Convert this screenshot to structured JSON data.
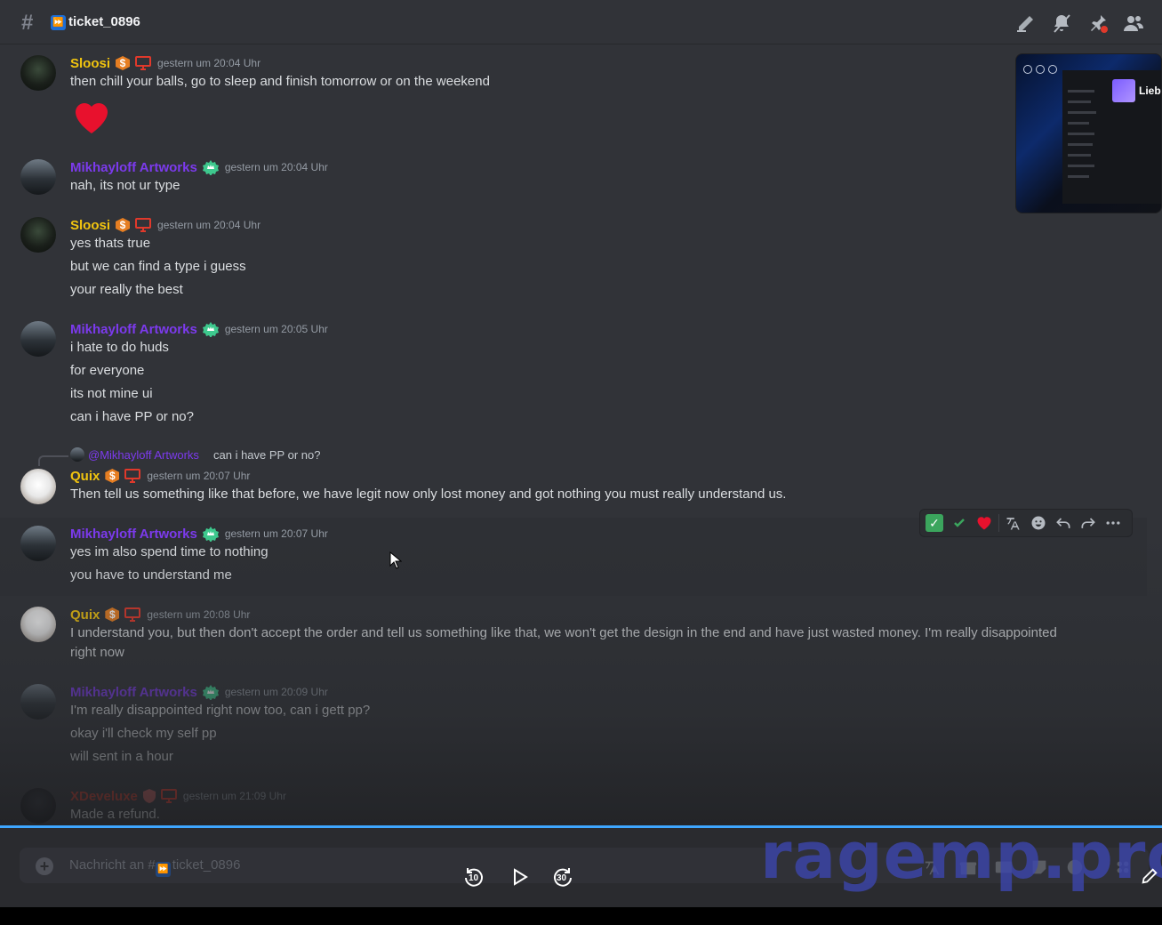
{
  "channel": {
    "name": "ticket_0896",
    "emoji": "⏩"
  },
  "messages": [
    {
      "author": "Sloosi",
      "timestamp": "gestern um 20:04 Uhr",
      "lines": [
        "then chill your balls, go to sleep and finish tomorrow or on the weekend"
      ],
      "emoji": "heart"
    },
    {
      "author": "Mikhayloff Artworks",
      "timestamp": "gestern um 20:04 Uhr",
      "lines": [
        "nah, its not ur type"
      ]
    },
    {
      "author": "Sloosi",
      "timestamp": "gestern um 20:04 Uhr",
      "lines": [
        "yes thats true",
        "but we can find a type i guess",
        "your really the best"
      ]
    },
    {
      "author": "Mikhayloff Artworks",
      "timestamp": "gestern um 20:05 Uhr",
      "lines": [
        "i hate to do huds",
        "for everyone",
        "its not mine ui",
        "can i have PP or no?"
      ]
    },
    {
      "author": "Quix",
      "timestamp": "gestern um 20:07 Uhr",
      "reply": {
        "mention": "@Mikhayloff Artworks",
        "text": "can i have PP or no?"
      },
      "lines": [
        "Then tell us something like that before, we have legit now only lost money and got nothing you must really understand us."
      ]
    },
    {
      "author": "Mikhayloff Artworks",
      "timestamp": "gestern um 20:07 Uhr",
      "lines": [
        "yes im also spend time to nothing",
        "you have to understand me"
      ]
    },
    {
      "author": "Quix",
      "timestamp": "gestern um 20:08 Uhr",
      "lines": [
        "I understand you, but then don't accept the order and tell us something like that, we won't get the design in the end and have just wasted money. I'm really disappointed right now"
      ]
    },
    {
      "author": "Mikhayloff Artworks",
      "timestamp": "gestern um 20:09 Uhr",
      "lines": [
        "I'm really disappointed right now too, can i gett pp?",
        "okay i'll check my self pp",
        "will sent in a hour"
      ]
    },
    {
      "author": "XDeveluxe",
      "timestamp": "gestern um 21:09 Uhr",
      "lines": [
        "Made a refund."
      ]
    }
  ],
  "thumbnail": {
    "label": "Liebl"
  },
  "composer": {
    "placeholder_prefix": "Nachricht an #",
    "placeholder_channel": "ticket_0896"
  },
  "player": {
    "rewind_seconds": "10",
    "forward_seconds": "30",
    "progress": 1.0
  },
  "watermark": "ragemp.pro",
  "colors": {
    "accent_blue": "#3ea6ff",
    "mikhayloff": "#7c3aed",
    "sloosi": "#f1c40f",
    "xdeveluxe": "#c0392b"
  }
}
